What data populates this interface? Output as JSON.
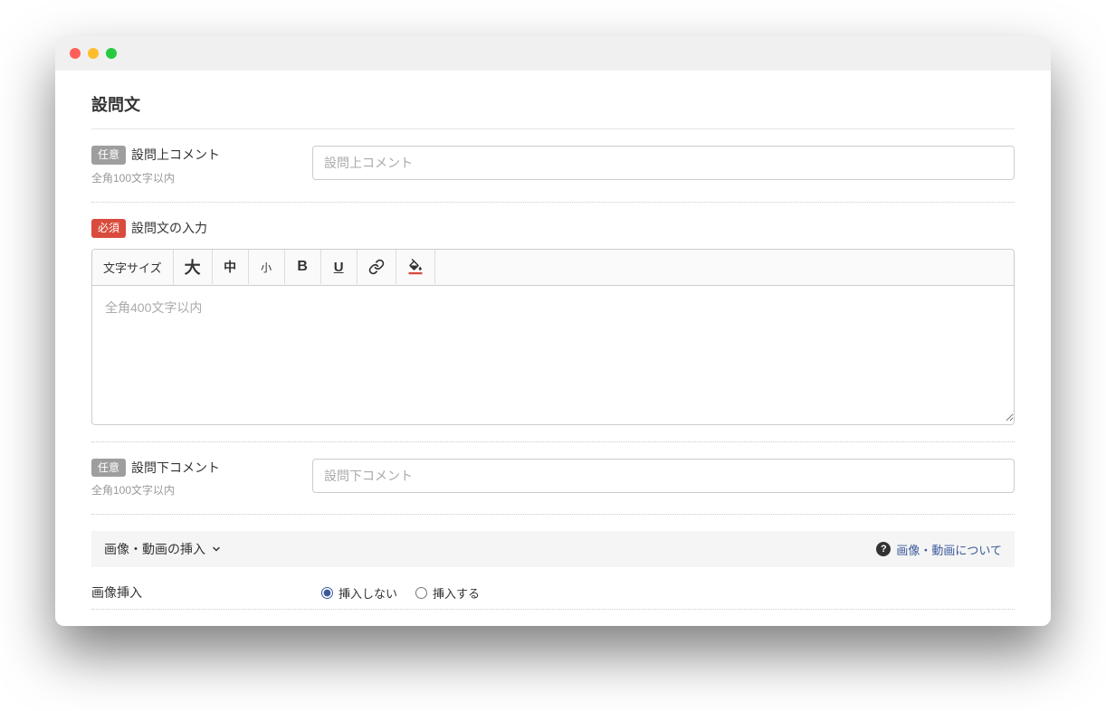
{
  "page": {
    "title": "設問文"
  },
  "upperComment": {
    "badge": "任意",
    "label": "設問上コメント",
    "hint": "全角100文字以内",
    "placeholder": "設問上コメント"
  },
  "questionBody": {
    "badge": "必須",
    "label": "設問文の入力",
    "toolbar": {
      "sizeLabel": "文字サイズ",
      "sizeLarge": "大",
      "sizeMedium": "中",
      "sizeSmall": "小"
    },
    "placeholder": "全角400文字以内"
  },
  "lowerComment": {
    "badge": "任意",
    "label": "設問下コメント",
    "hint": "全角100文字以内",
    "placeholder": "設問下コメント"
  },
  "mediaSection": {
    "title": "画像・動画の挿入",
    "helpText": "画像・動画について"
  },
  "imageInsert": {
    "label": "画像挿入",
    "optionNo": "挿入しない",
    "optionYes": "挿入する"
  }
}
